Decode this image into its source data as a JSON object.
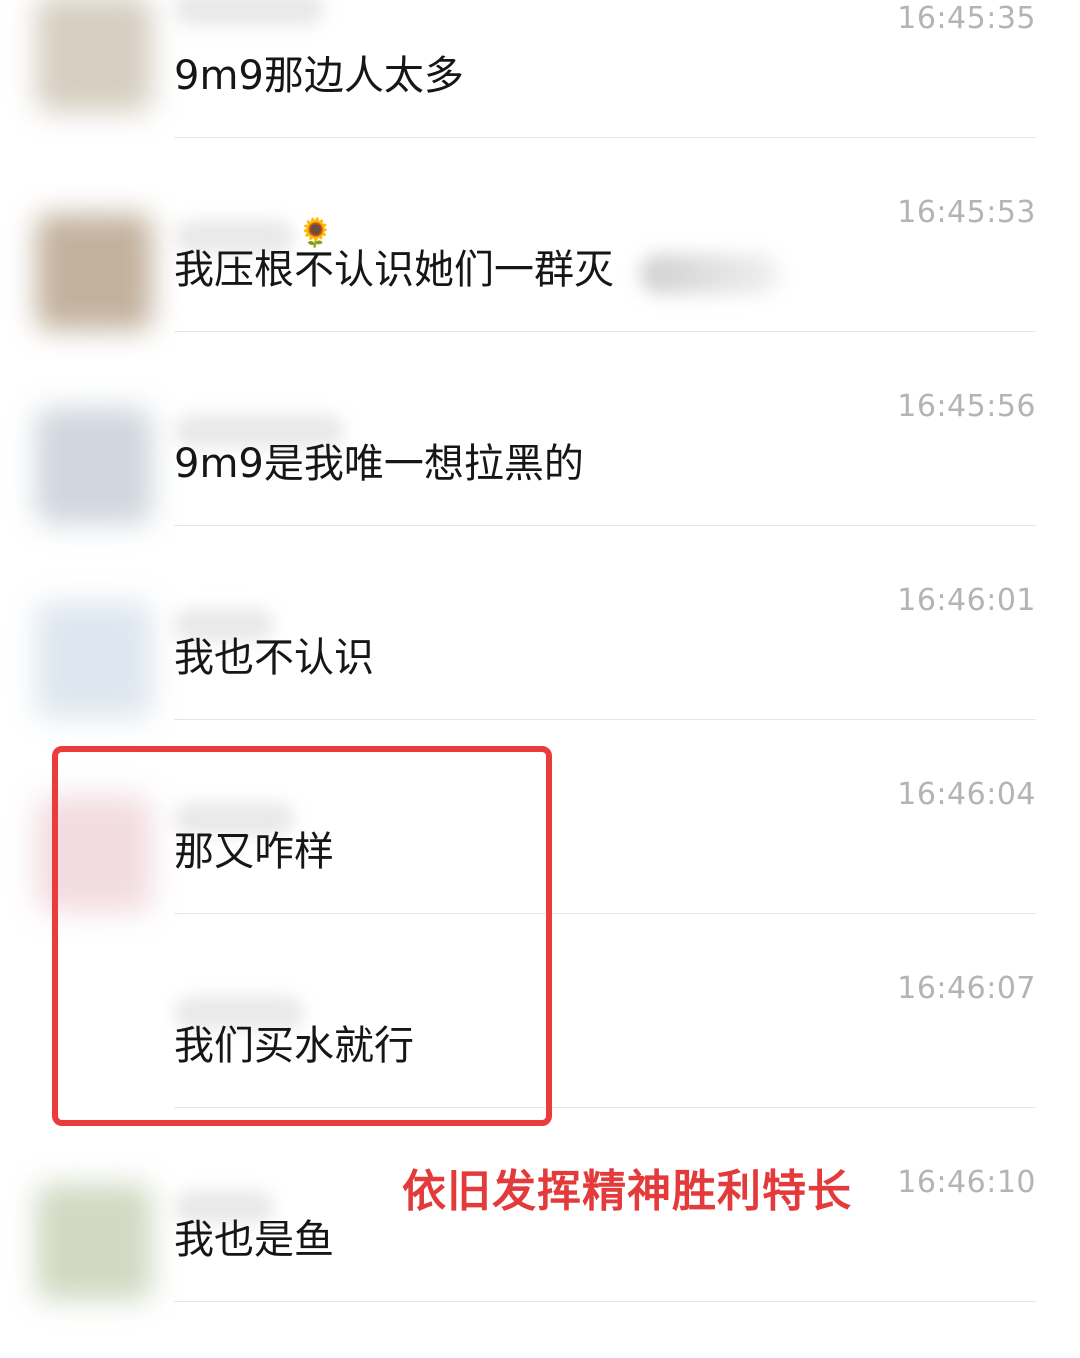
{
  "messages": [
    {
      "time": "16:45:35",
      "text": "9m9那边人太多",
      "avatar_color": "#cfc6b6"
    },
    {
      "time": "16:45:53",
      "text": "我压根不认识她们一群灭",
      "avatar_color": "#b8a48c",
      "name_emoji": "🌻"
    },
    {
      "time": "16:45:56",
      "text": "9m9是我唯一想拉黑的",
      "avatar_color": "#c7cfd8"
    },
    {
      "time": "16:46:01",
      "text": "我也不认识",
      "avatar_color": "#d8e2ec"
    },
    {
      "time": "16:46:04",
      "text": "那又咋样",
      "avatar_color": "#f0d6dc"
    },
    {
      "time": "16:46:07",
      "text": "我们买水就行",
      "avatar_color": "#ffffff"
    },
    {
      "time": "16:46:10",
      "text": "我也是鱼",
      "avatar_color": "#c9d3b8"
    }
  ],
  "annotation": {
    "text": "依旧发挥精神胜利特长",
    "color": "#e33b3b"
  },
  "highlight_color": "#ea3c3c"
}
